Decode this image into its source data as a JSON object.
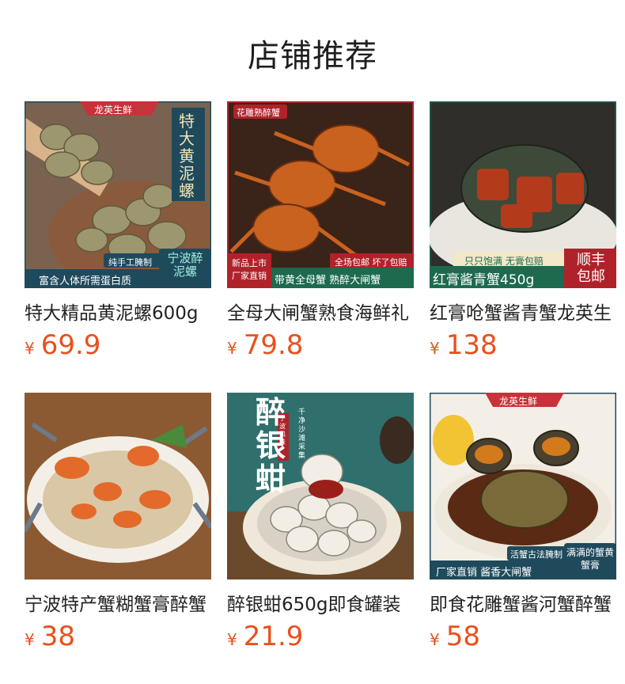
{
  "header": {
    "title": "店铺推荐"
  },
  "currency": "¥",
  "products": [
    {
      "name": "特大精品黄泥螺600g",
      "price": "69.9",
      "image": {
        "brand": "龙英生鲜",
        "side_text": "特大黄泥螺",
        "badge1": "纯手工腌制",
        "badge2": "宁波醉泥螺",
        "bottom": "富含人体所需蛋白质"
      }
    },
    {
      "name": "全母大闸蟹熟食海鲜礼",
      "price": "79.8",
      "image": {
        "label": "花雕熟醉蟹",
        "promo": "全场包邮 坏了包赔",
        "left_tag": "新品上市厂家直销",
        "bottom": "带黄全母蟹   熟醉大闸蟹"
      }
    },
    {
      "name": "红膏呛蟹酱青蟹龙英生",
      "price": "138",
      "image": {
        "promo": "只只饱满 无膏包赔",
        "bottom": "红膏酱青蟹450g",
        "badge": "顺丰包邮"
      }
    },
    {
      "name": "宁波特产蟹糊蟹膏醉蟹",
      "price": "38",
      "image": {}
    },
    {
      "name": "醉银蚶650g即食罐装",
      "price": "21.9",
      "image": {
        "headline": "醉银蚶",
        "seal": "宁波风味",
        "sub": "千净沙滩采集"
      }
    },
    {
      "name": "即食花雕蟹酱河蟹醉蟹",
      "price": "58",
      "image": {
        "brand": "龙英生鲜",
        "badge1": "活蟹古法腌制",
        "badge2": "满满的蟹黄蟹膏",
        "bottom": "厂家直销   酱香大闸蟹"
      }
    }
  ]
}
